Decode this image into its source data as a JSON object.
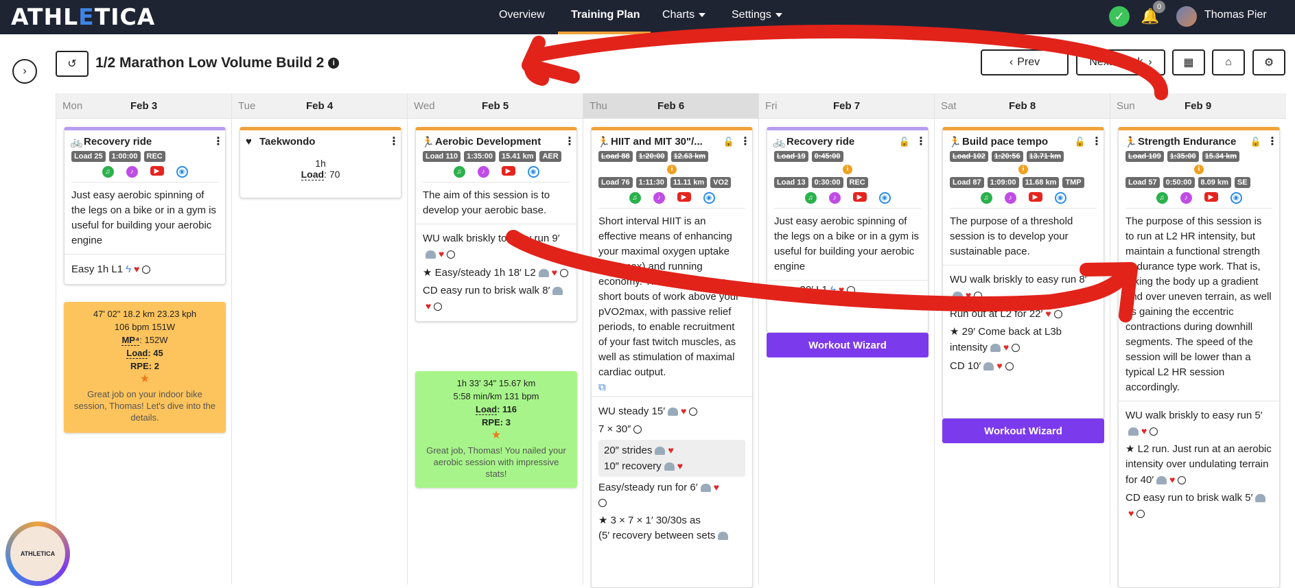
{
  "brand": {
    "logo_pre": "ATHL",
    "logo_e": "E",
    "logo_post": "TICA"
  },
  "nav": {
    "items": [
      "Overview",
      "Training Plan",
      "Charts",
      "Settings"
    ],
    "active": "Training Plan"
  },
  "user": {
    "notification_count": "0",
    "name": "Thomas Pier"
  },
  "plan": {
    "title": "1/2 Marathon Low Volume Build 2",
    "prev_label": "Prev",
    "next_label": "Next Week"
  },
  "days": [
    {
      "name": "Mon",
      "date": "Feb 3"
    },
    {
      "name": "Tue",
      "date": "Feb 4"
    },
    {
      "name": "Wed",
      "date": "Feb 5"
    },
    {
      "name": "Thu",
      "date": "Feb 6"
    },
    {
      "name": "Fri",
      "date": "Feb 7"
    },
    {
      "name": "Sat",
      "date": "Feb 8"
    },
    {
      "name": "Sun",
      "date": "Feb 9"
    }
  ],
  "mon": {
    "title": "Recovery ride",
    "tags": [
      "Load 25",
      "1:00:00",
      "REC"
    ],
    "desc": "Just easy aerobic spinning of the legs on a bike or in a gym is useful for building your aerobic engine",
    "step": "Easy 1h L1",
    "result": {
      "line1": "47' 02\"   18.2 km   23.23 kph",
      "line2": "106 bpm   151W",
      "mp_label": "MP⁴",
      "mp_val": ": 152W",
      "load_label": "Load",
      "load_val": ": 45",
      "rpe_label": "RPE",
      "rpe_val": ": 2",
      "msg": "Great job on your indoor bike session, Thomas! Let's dive into the details."
    }
  },
  "tue": {
    "title": "Taekwondo",
    "dur": "1h",
    "load_label": "Load",
    "load_val": ": 70"
  },
  "wed": {
    "title": "Aerobic Development",
    "tags": [
      "Load 110",
      "1:35:00",
      "15.41 km",
      "AER"
    ],
    "desc": "The aim of this session is to develop your aerobic base.",
    "steps": [
      "WU walk briskly to easy run 9′",
      "Easy/steady 1h 18′ L2",
      "CD easy run to brisk walk 8′"
    ],
    "result": {
      "line1": "1h 33' 34\"   15.67 km",
      "line2": "5:58 min/km   131 bpm",
      "load_label": "Load",
      "load_val": ": 116",
      "rpe_label": "RPE",
      "rpe_val": ": 3",
      "msg": "Great job, Thomas! You nailed your aerobic session with impressive stats!"
    }
  },
  "thu": {
    "title": "HIIT and MIT 30\"/...",
    "tags_planned": [
      "Load 88",
      "1:20:00",
      "12.63 km"
    ],
    "tags_actual": [
      "Load 76",
      "1:11:30",
      "11.11 km",
      "VO2"
    ],
    "desc": "Short interval HIIT is an effective means of enhancing your maximal oxygen uptake (VO2max) and running economy. The workout uses short bouts of work above your pVO2max, with passive relief periods, to enable recruitment of your fast twitch muscles, as well as stimulation of maximal cardiac output.",
    "steps": [
      "WU steady 15′",
      "7 × 30″",
      "20″ strides",
      "10″ recovery",
      "Easy/steady run for 6′",
      "3 × 7 × 1′ 30/30s as",
      "(5′ recovery between sets"
    ]
  },
  "fri": {
    "title": "Recovery ride",
    "tags_planned": [
      "Load 19",
      "0:45:00"
    ],
    "tags_actual": [
      "Load 13",
      "0:30:00",
      "REC"
    ],
    "desc": "Just easy aerobic spinning of the legs on a bike or in a gym is useful for building your aerobic engine",
    "step": "Easy 30′ L1",
    "wizard": "Workout Wizard"
  },
  "sat": {
    "title": "Build pace tempo",
    "tags_planned": [
      "Load 102",
      "1:20:56",
      "13.71 km"
    ],
    "tags_actual": [
      "Load 87",
      "1:09:00",
      "11.68 km",
      "TMP"
    ],
    "desc": "The purpose of a threshold session is to develop your sustainable pace.",
    "steps": [
      "WU walk briskly to easy run 8′",
      "Run out at L2 for 22′",
      "29′ Come back at L3b intensity",
      "CD 10′"
    ],
    "wizard": "Workout Wizard"
  },
  "sun": {
    "title": "Strength Endurance",
    "tags_planned": [
      "Load 109",
      "1:35:00",
      "15.34 km"
    ],
    "tags_actual": [
      "Load 57",
      "0:50:00",
      "8.09 km",
      "SE"
    ],
    "desc": "The purpose of this session is to run at L2 HR intensity, but maintain a functional strength endurance type work. That is, taking the body up a gradient and over uneven terrain, as well as gaining the eccentric contractions during downhill segments. The speed of the session will be lower than a typical L2 HR session accordingly.",
    "steps": [
      "WU walk briskly to easy run 5′",
      "L2 run. Just run at an aerobic intensity over undulating terrain for 40′",
      "CD easy run to brisk walk 5′"
    ]
  },
  "coach_avatar": {
    "label": "ATHLETICA"
  },
  "colors": {
    "topbar": "#1f2433",
    "accent_orange": "#f0a33a",
    "wizard_purple": "#7c3aed",
    "done_green": "#a7f58a",
    "done_orange": "#fdc45d",
    "annotation_red": "#e2231a"
  }
}
